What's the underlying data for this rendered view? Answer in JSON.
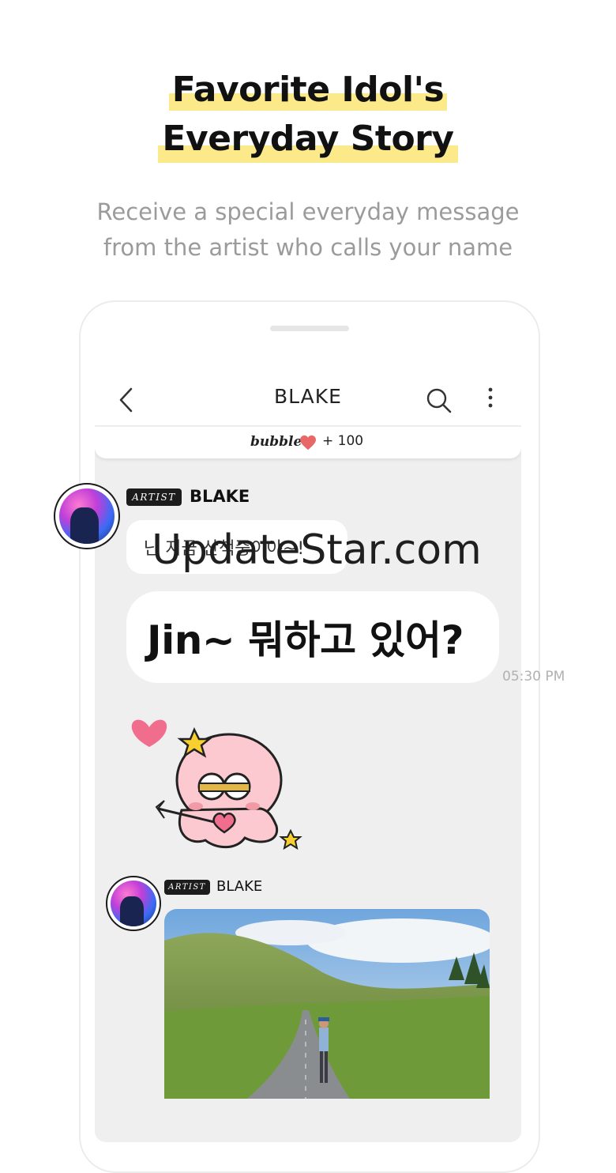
{
  "promo": {
    "title_line1": "Favorite Idol's",
    "title_line2": "Everyday Story",
    "subtitle_line1": "Receive a special everyday message",
    "subtitle_line2": "from the artist who calls your name",
    "highlight_color": "#fbe98a"
  },
  "chat": {
    "title": "BLAKE",
    "bubble_label": "bubble",
    "bubble_count": "+ 100",
    "icons": [
      "back-icon",
      "search-icon",
      "more-icon",
      "heart-icon"
    ]
  },
  "messages": [
    {
      "badge": "ARTIST",
      "sender": "BLAKE",
      "text_small": "난 지금 산책중이야~!",
      "text_big": "Jin~ 뭐하고 있어?",
      "time": "05:30 PM"
    },
    {
      "badge": "ARTIST",
      "sender": "BLAKE",
      "attachment": "photo"
    }
  ],
  "watermark": "UpdateStar.com"
}
